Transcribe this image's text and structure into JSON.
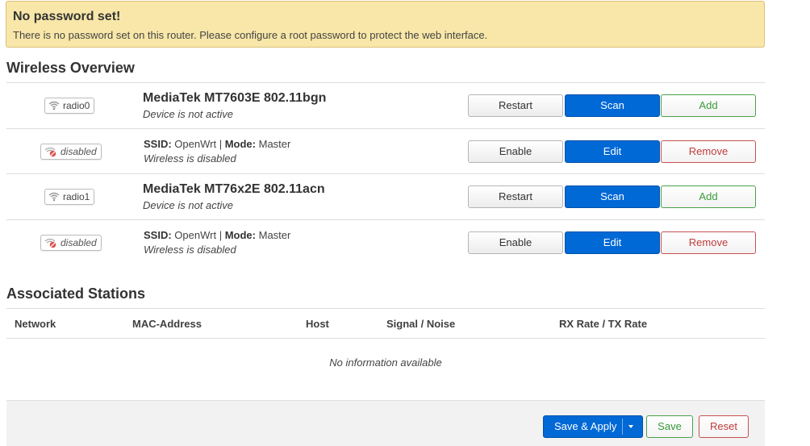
{
  "alert": {
    "title": "No password set!",
    "text": "There is no password set on this router. Please configure a root password to protect the web interface."
  },
  "wireless": {
    "title": "Wireless Overview",
    "devices": [
      {
        "badge": "radio0",
        "title": "MediaTek MT7603E 802.11bgn",
        "status": "Device is not active",
        "buttons": [
          "Restart",
          "Scan",
          "Add"
        ],
        "network": {
          "badge": "disabled",
          "ssid_label": "SSID:",
          "ssid": "OpenWrt",
          "sep": "|",
          "mode_label": "Mode:",
          "mode": "Master",
          "status": "Wireless is disabled",
          "buttons": [
            "Enable",
            "Edit",
            "Remove"
          ]
        }
      },
      {
        "badge": "radio1",
        "title": "MediaTek MT76x2E 802.11acn",
        "status": "Device is not active",
        "buttons": [
          "Restart",
          "Scan",
          "Add"
        ],
        "network": {
          "badge": "disabled",
          "ssid_label": "SSID:",
          "ssid": "OpenWrt",
          "sep": "|",
          "mode_label": "Mode:",
          "mode": "Master",
          "status": "Wireless is disabled",
          "buttons": [
            "Enable",
            "Edit",
            "Remove"
          ]
        }
      }
    ]
  },
  "stations": {
    "title": "Associated Stations",
    "columns": [
      "Network",
      "MAC-Address",
      "Host",
      "Signal / Noise",
      "RX Rate / TX Rate"
    ],
    "empty": "No information available"
  },
  "footer": {
    "save_apply": "Save & Apply",
    "save": "Save",
    "reset": "Reset"
  },
  "colors": {
    "primary": "#0069d6",
    "positive": "#3a9a3a",
    "negative": "#c03c3c",
    "alert_bg": "#f8e7a8"
  }
}
